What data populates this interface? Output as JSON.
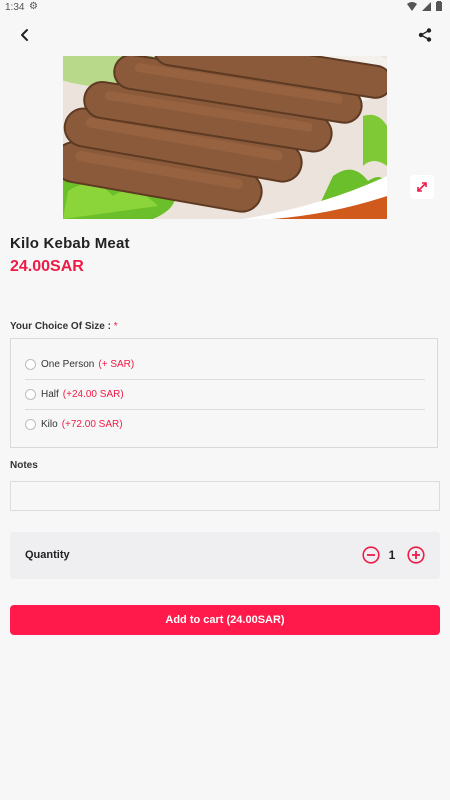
{
  "status_bar": {
    "time": "1:34",
    "icons": [
      "settings-icon",
      "wifi-icon",
      "signal-icon",
      "battery-icon"
    ]
  },
  "app_bar": {
    "back_icon": "back-arrow-icon",
    "share_icon": "share-icon"
  },
  "product": {
    "name": "Kilo Kebab Meat",
    "price": "24.00SAR",
    "expand_icon": "expand-icon"
  },
  "size_choice": {
    "label": "Your Choice Of Size :",
    "required_mark": "*",
    "options": [
      {
        "name": "One Person",
        "extra": "(+ SAR)"
      },
      {
        "name": "Half",
        "extra": "(+24.00 SAR)"
      },
      {
        "name": "Kilo",
        "extra": "(+72.00 SAR)"
      }
    ]
  },
  "notes": {
    "label": "Notes",
    "value": "",
    "placeholder": ""
  },
  "quantity": {
    "label": "Quantity",
    "value": "1"
  },
  "add_to_cart": {
    "label": "Add to cart (24.00SAR)"
  },
  "colors": {
    "accent": "#ff1a4b",
    "price": "#ef1b47",
    "background": "#f7f7f7"
  }
}
